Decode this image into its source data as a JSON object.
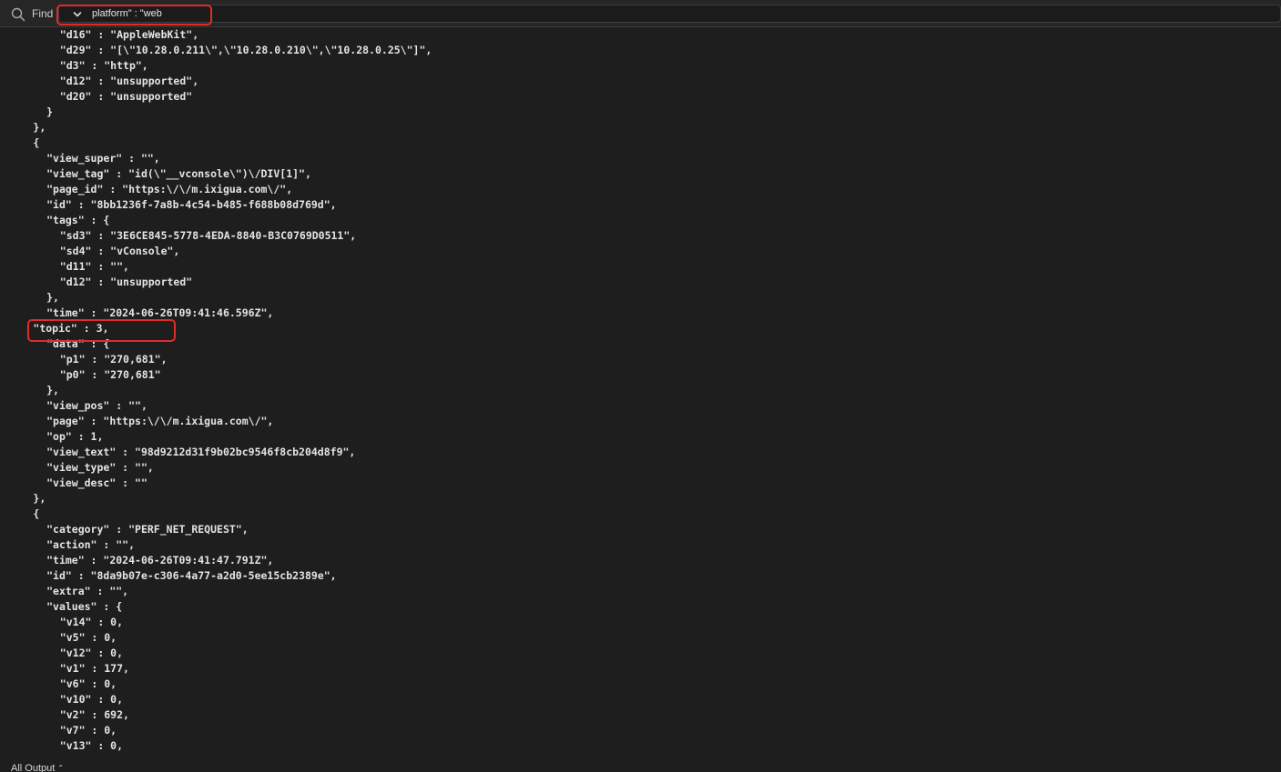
{
  "find": {
    "label": "Find",
    "query": "platform\" : \"web"
  },
  "output": {
    "lines": [
      {
        "indent": 4,
        "text": "\"d16\" : \"AppleWebKit\","
      },
      {
        "indent": 4,
        "text": "\"d29\" : \"[\\\"10.28.0.211\\\",\\\"10.28.0.210\\\",\\\"10.28.0.25\\\"]\","
      },
      {
        "indent": 4,
        "text": "\"d3\" : \"http\","
      },
      {
        "indent": 4,
        "text": "\"d12\" : \"unsupported\","
      },
      {
        "indent": 4,
        "text": "\"d20\" : \"unsupported\""
      },
      {
        "indent": 3,
        "text": "}"
      },
      {
        "indent": 2,
        "text": "},"
      },
      {
        "indent": 2,
        "text": "{"
      },
      {
        "indent": 3,
        "text": "\"view_super\" : \"\","
      },
      {
        "indent": 3,
        "text": "\"view_tag\" : \"id(\\\"__vconsole\\\")\\/DIV[1]\","
      },
      {
        "indent": 3,
        "text": "\"page_id\" : \"https:\\/\\/m.ixigua.com\\/\","
      },
      {
        "indent": 3,
        "text": "\"id\" : \"8bb1236f-7a8b-4c54-b485-f688b08d769d\","
      },
      {
        "indent": 3,
        "text": "\"tags\" : {"
      },
      {
        "indent": 4,
        "text": "\"sd3\" : \"3E6CE845-5778-4EDA-8840-B3C0769D0511\","
      },
      {
        "indent": 4,
        "text": "\"sd4\" : \"vConsole\","
      },
      {
        "indent": 4,
        "text": "\"d11\" : \"\","
      },
      {
        "indent": 4,
        "text": "\"d12\" : \"unsupported\""
      },
      {
        "indent": 3,
        "text": "},"
      },
      {
        "indent": 3,
        "text": "\"time\" : \"2024-06-26T09:41:46.596Z\","
      },
      {
        "indent": 2,
        "text": "\"topic\" : 3,"
      },
      {
        "indent": 3,
        "text": "\"data\" : {"
      },
      {
        "indent": 4,
        "text": "\"p1\" : \"270,681\","
      },
      {
        "indent": 4,
        "text": "\"p0\" : \"270,681\""
      },
      {
        "indent": 3,
        "text": "},"
      },
      {
        "indent": 3,
        "text": "\"view_pos\" : \"\","
      },
      {
        "indent": 3,
        "text": "\"page\" : \"https:\\/\\/m.ixigua.com\\/\","
      },
      {
        "indent": 3,
        "text": "\"op\" : 1,"
      },
      {
        "indent": 3,
        "text": "\"view_text\" : \"98d9212d31f9b02bc9546f8cb204d8f9\","
      },
      {
        "indent": 3,
        "text": "\"view_type\" : \"\","
      },
      {
        "indent": 3,
        "text": "\"view_desc\" : \"\""
      },
      {
        "indent": 2,
        "text": "},"
      },
      {
        "indent": 2,
        "text": "{"
      },
      {
        "indent": 3,
        "text": "\"category\" : \"PERF_NET_REQUEST\","
      },
      {
        "indent": 3,
        "text": "\"action\" : \"\","
      },
      {
        "indent": 3,
        "text": "\"time\" : \"2024-06-26T09:41:47.791Z\","
      },
      {
        "indent": 3,
        "text": "\"id\" : \"8da9b07e-c306-4a77-a2d0-5ee15cb2389e\","
      },
      {
        "indent": 3,
        "text": "\"extra\" : \"\","
      },
      {
        "indent": 3,
        "text": "\"values\" : {"
      },
      {
        "indent": 4,
        "text": "\"v14\" : 0,"
      },
      {
        "indent": 4,
        "text": "\"v5\" : 0,"
      },
      {
        "indent": 4,
        "text": "\"v12\" : 0,"
      },
      {
        "indent": 4,
        "text": "\"v1\" : 177,"
      },
      {
        "indent": 4,
        "text": "\"v6\" : 0,"
      },
      {
        "indent": 4,
        "text": "\"v10\" : 0,"
      },
      {
        "indent": 4,
        "text": "\"v2\" : 692,"
      },
      {
        "indent": 4,
        "text": "\"v7\" : 0,"
      },
      {
        "indent": 4,
        "text": "\"v13\" : 0,"
      }
    ]
  },
  "status": {
    "output_filter": "All Output"
  },
  "icons": {
    "find": "magnifier-icon",
    "history": "chevron-down-icon",
    "filter": "up-down-arrows-icon"
  },
  "colors": {
    "background": "#1e1e1e",
    "text": "#e4e4e4",
    "annotation": "#e02b2b"
  }
}
